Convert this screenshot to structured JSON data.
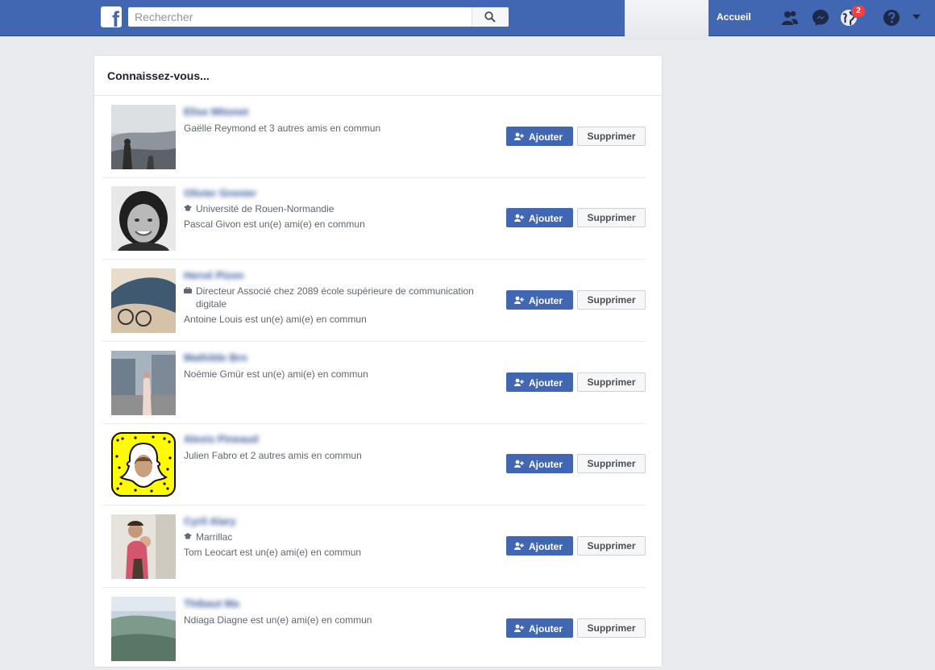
{
  "topbar": {
    "logo": "f",
    "search_placeholder": "Rechercher",
    "home_label": "Accueil",
    "notification_count": "2",
    "colors": {
      "brand": "#4267b2",
      "badge": "#fa3e3e"
    }
  },
  "card": {
    "title": "Connaissez-vous...",
    "add_label": "Ajouter",
    "remove_label": "Supprimer",
    "people": [
      {
        "name": "Elise Mitonet",
        "details": [],
        "mutual": "Gaëlle Reymond et 3 autres amis en commun",
        "avatar": "landscape-photo"
      },
      {
        "name": "Olivier Grenier",
        "details": [
          {
            "icon": "school-icon",
            "text": "Université de Rouen-Normandie"
          }
        ],
        "mutual": "Pascal Givon est un(e) ami(e) en commun",
        "avatar": "portrait-photo"
      },
      {
        "name": "Hervé Pizon",
        "details": [
          {
            "icon": "briefcase-icon",
            "text": "Directeur Associé chez 2089 école supérieure de communication digitale"
          }
        ],
        "mutual": "Antoine Louis est un(e) ami(e) en commun",
        "avatar": "closeup-photo"
      },
      {
        "name": "Mathilde Brn",
        "details": [],
        "mutual": "Noémie Gmür est un(e) ami(e) en commun",
        "avatar": "street-photo"
      },
      {
        "name": "Alexis Pineaud",
        "details": [],
        "mutual": "Julien Fabro et 2 autres amis en commun",
        "avatar": "snapcode"
      },
      {
        "name": "Cyril Alary",
        "details": [
          {
            "icon": "school-icon",
            "text": "Marrillac"
          }
        ],
        "mutual": "Tom Leocart est un(e) ami(e) en commun",
        "avatar": "family-photo"
      },
      {
        "name": "Thibaut Ma",
        "details": [],
        "mutual": "Ndiaga Diagne est un(e) ami(e) en commun",
        "avatar": "coast-photo"
      }
    ]
  }
}
